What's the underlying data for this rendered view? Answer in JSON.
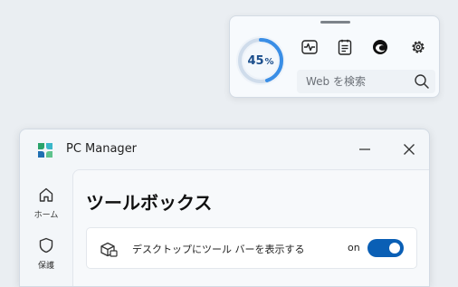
{
  "widget": {
    "gauge": {
      "value": 0.45,
      "percent_number": "45",
      "percent_sign": "%"
    },
    "icons": [
      "heart-rate-icon",
      "notes-icon",
      "edge-browser-icon",
      "settings-gear-icon"
    ],
    "search": {
      "placeholder": "Web を検索"
    }
  },
  "window": {
    "title": "PC Manager",
    "nav": [
      {
        "icon": "home-icon",
        "label": "ホーム"
      },
      {
        "icon": "shield-icon",
        "label": "保護"
      }
    ],
    "page_title": "ツールボックス",
    "card": {
      "label": "デスクトップにツール バーを表示する",
      "toggle_state": "on"
    }
  },
  "colors": {
    "accent": "#0a5fb5",
    "gauge_text": "#1b4e8c",
    "gauge_ring": "#3a8ee6"
  }
}
